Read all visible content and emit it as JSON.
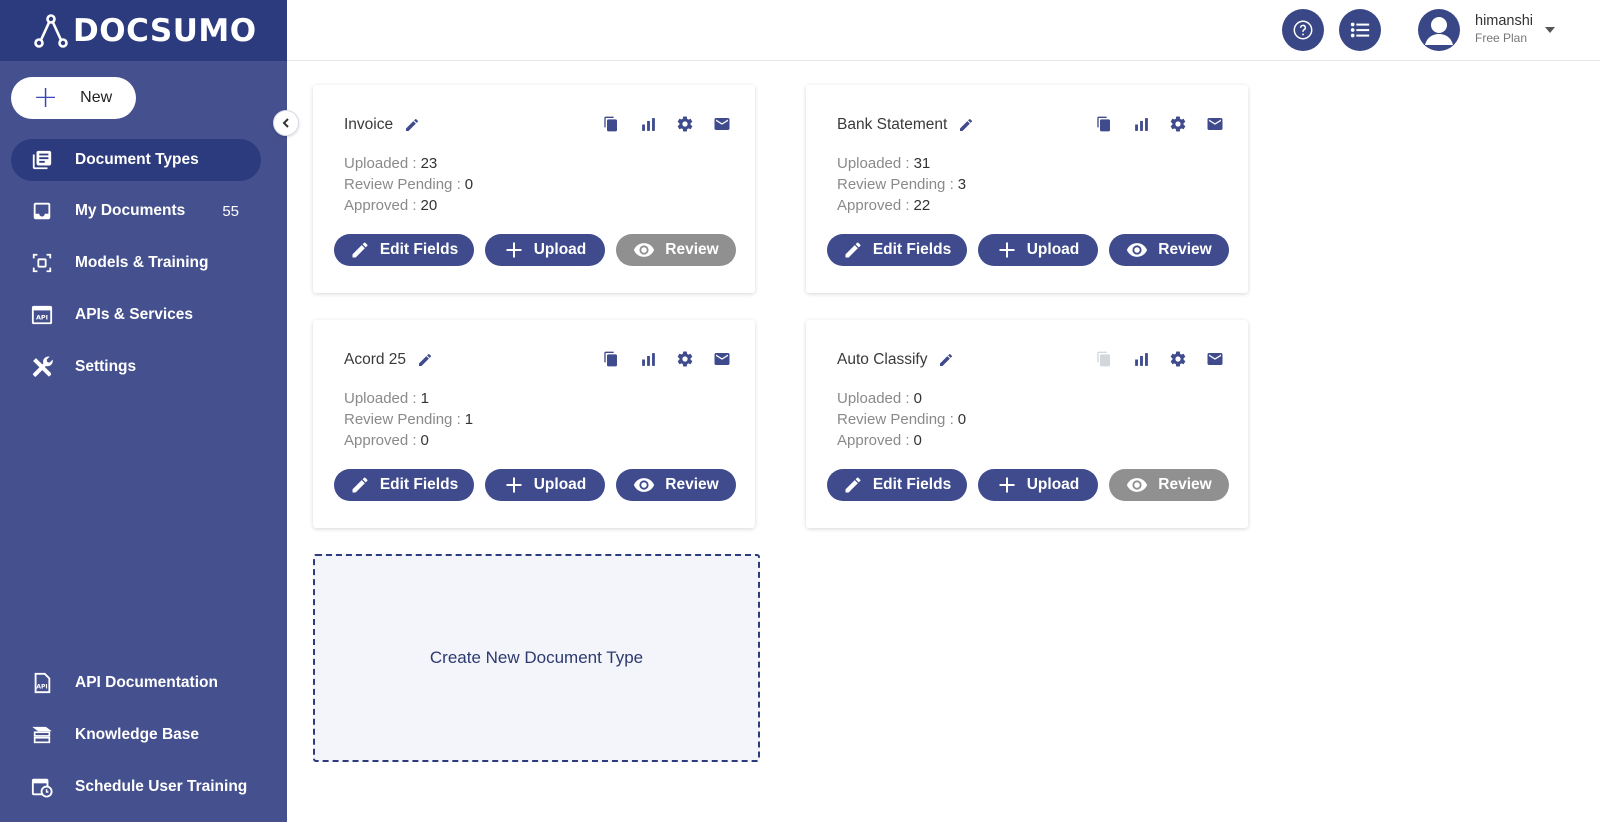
{
  "brand": {
    "name": "DOCSUMO"
  },
  "sidebar": {
    "new_label": "New",
    "items": [
      {
        "label": "Document Types",
        "icon": "library-books-icon",
        "active": true
      },
      {
        "label": "My Documents",
        "icon": "inbox-icon",
        "count": "55"
      },
      {
        "label": "Models & Training",
        "icon": "ai-model-icon"
      },
      {
        "label": "APIs & Services",
        "icon": "api-icon"
      },
      {
        "label": "Settings",
        "icon": "tools-icon"
      }
    ],
    "bottom_items": [
      {
        "label": "API Documentation",
        "icon": "api-doc-icon"
      },
      {
        "label": "Knowledge Base",
        "icon": "knowledge-base-icon"
      },
      {
        "label": "Schedule User Training",
        "icon": "calendar-clock-icon"
      }
    ]
  },
  "user": {
    "name": "himanshi",
    "plan": "Free Plan"
  },
  "stat_labels": {
    "uploaded": "Uploaded :",
    "review_pending": "Review Pending :",
    "approved": "Approved :"
  },
  "button_labels": {
    "edit_fields": "Edit Fields",
    "upload": "Upload",
    "review": "Review"
  },
  "cards": [
    {
      "title": "Invoice",
      "uploaded": "23",
      "review_pending": "0",
      "approved": "20",
      "review_enabled": false,
      "copy_enabled": true
    },
    {
      "title": "Bank Statement",
      "uploaded": "31",
      "review_pending": "3",
      "approved": "22",
      "review_enabled": true,
      "copy_enabled": true
    },
    {
      "title": "Acord 25",
      "uploaded": "1",
      "review_pending": "1",
      "approved": "0",
      "review_enabled": true,
      "copy_enabled": true
    },
    {
      "title": "Auto Classify",
      "uploaded": "0",
      "review_pending": "0",
      "approved": "0",
      "review_enabled": false,
      "copy_enabled": false
    }
  ],
  "create_new_label": "Create New Document Type",
  "colors": {
    "sidebar": "#45508e",
    "sidebar_dark": "#2c3a7e",
    "primary": "#3f4b8d",
    "disabled": "#909090"
  }
}
